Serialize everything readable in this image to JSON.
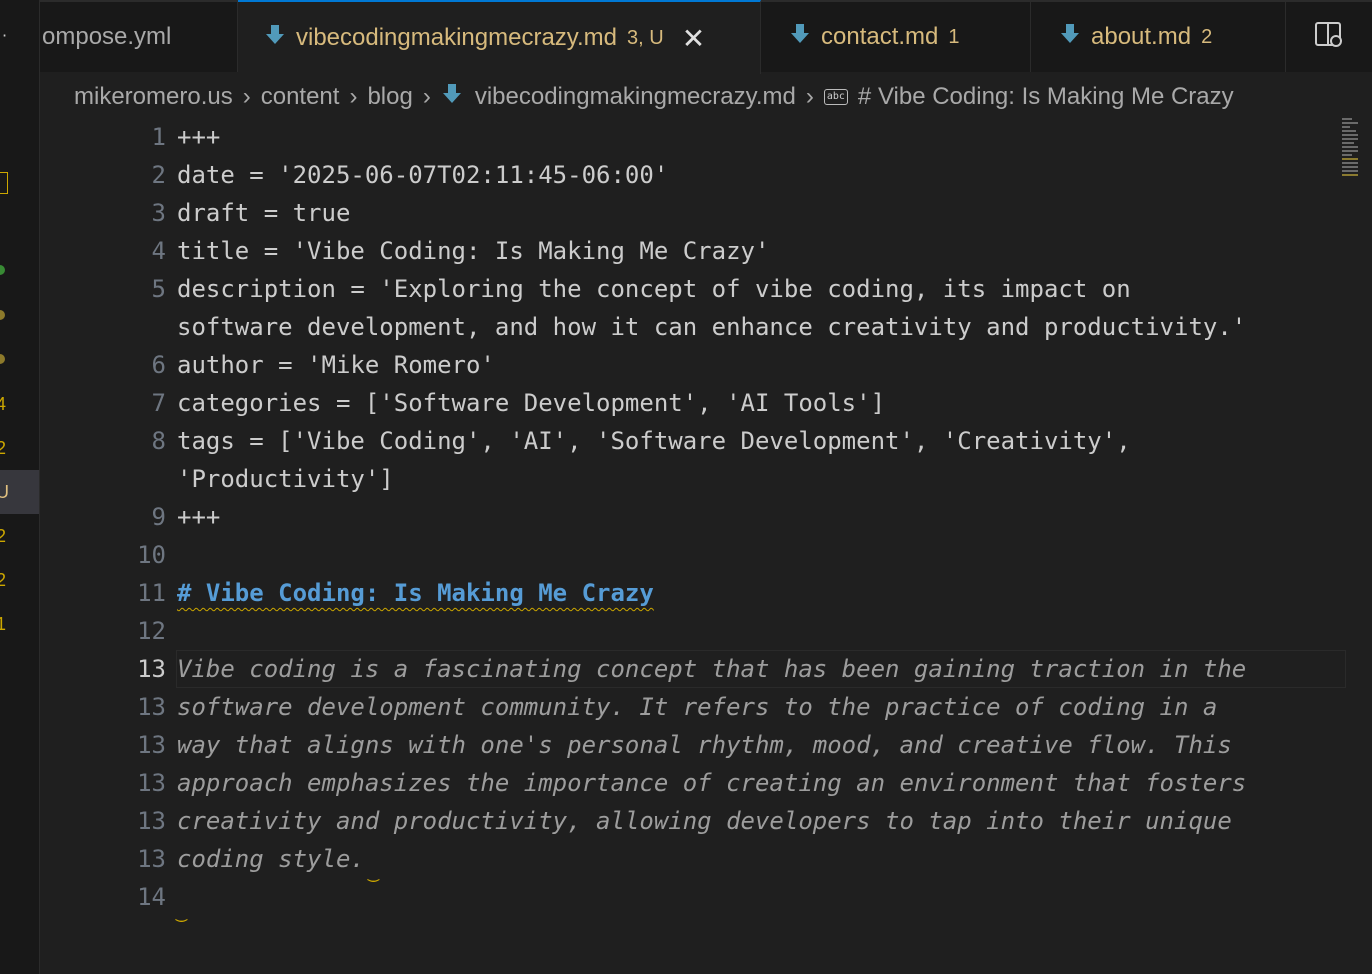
{
  "left_strip": {
    "markers": [
      "4",
      "2",
      "U",
      "2",
      "2",
      "1"
    ]
  },
  "tabs": [
    {
      "label": "ompose.yml",
      "status": ""
    },
    {
      "label": "vibecodingmakingmecrazy.md",
      "status": "3, U",
      "active": true
    },
    {
      "label": "contact.md",
      "status": "1"
    },
    {
      "label": "about.md",
      "status": "2"
    }
  ],
  "breadcrumb": {
    "items": [
      "mikeromero.us",
      "content",
      "blog",
      "vibecodingmakingmecrazy.md"
    ],
    "symbol_icon": "abc",
    "symbol": "# Vibe Coding: Is Making Me Crazy"
  },
  "editor": {
    "line_numbers": [
      "1",
      "2",
      "3",
      "4",
      "5",
      "",
      "6",
      "7",
      "8",
      "",
      "9",
      "10",
      "11",
      "12",
      "13",
      "13",
      "13",
      "13",
      "13",
      "13",
      "14"
    ],
    "lines": [
      "+++",
      "date = '2025-06-07T02:11:45-06:00'",
      "draft = true",
      "title = 'Vibe Coding: Is Making Me Crazy'",
      "description = 'Exploring the concept of vibe coding, its impact on",
      "software development, and how it can enhance creativity and productivity.'",
      "author = 'Mike Romero'",
      "categories = ['Software Development', 'AI Tools']",
      "tags = ['Vibe Coding', 'AI', 'Software Development', 'Creativity',",
      "'Productivity']",
      "+++",
      "",
      "# Vibe Coding: Is Making Me Crazy",
      "",
      "Vibe coding is a fascinating concept that has been gaining traction in the",
      "software development community. It refers to the practice of coding in a",
      "way that aligns with one's personal rhythm, mood, and creative flow. This",
      "approach emphasizes the importance of creating an environment that fosters",
      "creativity and productivity, allowing developers to tap into their unique",
      "coding style.",
      ""
    ]
  },
  "colors": {
    "accent": "#0078d4",
    "modified": "#d7ba7d",
    "heading": "#569cd6",
    "warning": "#cca700"
  },
  "icons": {
    "tab_file": "markdown-download-arrow-icon",
    "close": "close-icon",
    "split": "split-editor-icon"
  }
}
